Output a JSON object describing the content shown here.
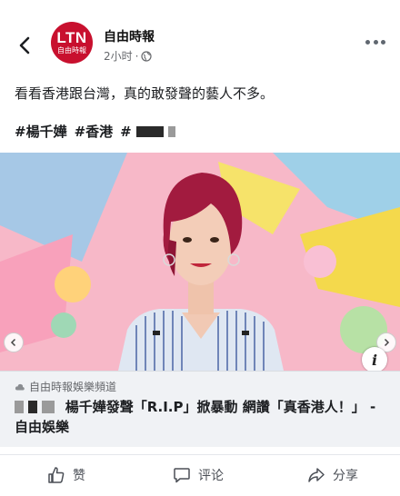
{
  "header": {
    "avatar_logo": "LTN",
    "avatar_logo_sub": "自由時報",
    "page_name": "自由時報",
    "time": "2小时",
    "separator": "·",
    "back_icon": "chevron-left-icon",
    "more_icon": "more-horizontal-icon",
    "globe_icon": "globe-icon"
  },
  "post": {
    "text": "看看香港跟台灣，真的敢發聲的藝人不多。",
    "hashtags": [
      "#楊千嬅",
      "#香港",
      "#"
    ]
  },
  "link_card": {
    "source": "自由時報娛樂頻道",
    "title": "楊千嬅發聲「R.I.P」掀暴動 網讚「真香港人！」 - 自由娛樂"
  },
  "actions": {
    "like": "赞",
    "comment": "评论",
    "share": "分享"
  },
  "colors": {
    "brand": "#c8102e",
    "text_primary": "#1c1e21",
    "text_secondary": "#65676b",
    "card_bg": "#f0f2f5"
  }
}
